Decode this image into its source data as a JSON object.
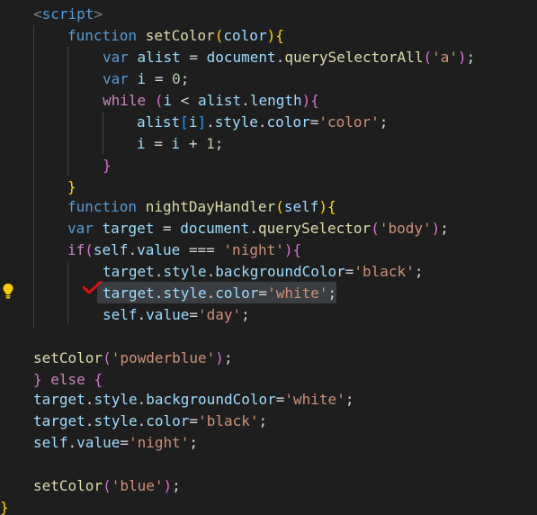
{
  "editor": {
    "background": "#1e1e1e",
    "colors": {
      "keyword": "#569cd6",
      "control": "#c586c0",
      "function": "#dcdcaa",
      "variable": "#9cdcfe",
      "string": "#ce9178",
      "number": "#b5cea8",
      "plain": "#d4d4d4",
      "bracket1": "#ffd700",
      "bracket2": "#da70d6",
      "bracket3": "#179fff",
      "tag": "#808080"
    },
    "lines": [
      [
        [
          "<",
          "tag"
        ],
        [
          "script",
          "keyword"
        ],
        [
          ">",
          "tag"
        ]
      ],
      [
        [
          "function",
          "keyword"
        ],
        [
          " ",
          "plain"
        ],
        [
          "setColor",
          "function"
        ],
        [
          "(",
          "bracket1"
        ],
        [
          "color",
          "variable"
        ],
        [
          "){",
          "bracket1"
        ]
      ],
      [
        [
          "var",
          "keyword"
        ],
        [
          " ",
          "plain"
        ],
        [
          "alist",
          "variable"
        ],
        [
          " = ",
          "plain"
        ],
        [
          "document",
          "variable"
        ],
        [
          ".",
          "plain"
        ],
        [
          "querySelectorAll",
          "function"
        ],
        [
          "(",
          "bracket2"
        ],
        [
          "'a'",
          "string"
        ],
        [
          ")",
          "bracket2"
        ],
        [
          ";",
          "plain"
        ]
      ],
      [
        [
          "var",
          "keyword"
        ],
        [
          " ",
          "plain"
        ],
        [
          "i",
          "variable"
        ],
        [
          " = ",
          "plain"
        ],
        [
          "0",
          "number"
        ],
        [
          ";",
          "plain"
        ]
      ],
      [
        [
          "while",
          "control"
        ],
        [
          " ",
          "plain"
        ],
        [
          "(",
          "bracket2"
        ],
        [
          "i",
          "variable"
        ],
        [
          " < ",
          "plain"
        ],
        [
          "alist",
          "variable"
        ],
        [
          ".",
          "plain"
        ],
        [
          "length",
          "variable"
        ],
        [
          ")",
          "bracket2"
        ],
        [
          "{",
          "bracket2"
        ]
      ],
      [
        [
          "alist",
          "variable"
        ],
        [
          "[",
          "bracket3"
        ],
        [
          "i",
          "variable"
        ],
        [
          "]",
          "bracket3"
        ],
        [
          ".",
          "plain"
        ],
        [
          "style",
          "variable"
        ],
        [
          ".",
          "plain"
        ],
        [
          "color",
          "variable"
        ],
        [
          "=",
          "plain"
        ],
        [
          "'color'",
          "string"
        ],
        [
          ";",
          "plain"
        ]
      ],
      [
        [
          "i",
          "variable"
        ],
        [
          " = ",
          "plain"
        ],
        [
          "i",
          "variable"
        ],
        [
          " + ",
          "plain"
        ],
        [
          "1",
          "number"
        ],
        [
          ";",
          "plain"
        ]
      ],
      [
        [
          "}",
          "bracket2"
        ]
      ],
      [
        [
          "}",
          "bracket1"
        ]
      ],
      [
        [
          "function",
          "keyword"
        ],
        [
          " ",
          "plain"
        ],
        [
          "nightDayHandler",
          "function"
        ],
        [
          "(",
          "bracket1"
        ],
        [
          "self",
          "variable"
        ],
        [
          "){",
          "bracket1"
        ]
      ],
      [
        [
          "var",
          "keyword"
        ],
        [
          " ",
          "plain"
        ],
        [
          "target",
          "variable"
        ],
        [
          " = ",
          "plain"
        ],
        [
          "document",
          "variable"
        ],
        [
          ".",
          "plain"
        ],
        [
          "querySelector",
          "function"
        ],
        [
          "(",
          "bracket2"
        ],
        [
          "'body'",
          "string"
        ],
        [
          ")",
          "bracket2"
        ],
        [
          ";",
          "plain"
        ]
      ],
      [
        [
          "if",
          "control"
        ],
        [
          "(",
          "bracket2"
        ],
        [
          "self",
          "variable"
        ],
        [
          ".",
          "plain"
        ],
        [
          "value",
          "variable"
        ],
        [
          " === ",
          "plain"
        ],
        [
          "'night'",
          "string"
        ],
        [
          ")",
          "bracket2"
        ],
        [
          "{",
          "bracket2"
        ]
      ],
      [
        [
          "target",
          "variable"
        ],
        [
          ".",
          "plain"
        ],
        [
          "style",
          "variable"
        ],
        [
          ".",
          "plain"
        ],
        [
          "backgroundColor",
          "variable"
        ],
        [
          "=",
          "plain"
        ],
        [
          "'black'",
          "string"
        ],
        [
          ";",
          "plain"
        ]
      ],
      [
        [
          "target",
          "variable"
        ],
        [
          ".",
          "plain"
        ],
        [
          "style",
          "variable"
        ],
        [
          ".",
          "plain"
        ],
        [
          "color",
          "variable"
        ],
        [
          "=",
          "plain"
        ],
        [
          "'white'",
          "string"
        ],
        [
          ";",
          "plain"
        ]
      ],
      [
        [
          "self",
          "variable"
        ],
        [
          ".",
          "plain"
        ],
        [
          "value",
          "variable"
        ],
        [
          "=",
          "plain"
        ],
        [
          "'day'",
          "string"
        ],
        [
          ";",
          "plain"
        ]
      ],
      [],
      [
        [
          "setColor",
          "function"
        ],
        [
          "(",
          "bracket2"
        ],
        [
          "'powderblue'",
          "string"
        ],
        [
          ")",
          "bracket2"
        ],
        [
          ";",
          "plain"
        ]
      ],
      [
        [
          "}",
          "bracket2"
        ],
        [
          " ",
          "plain"
        ],
        [
          "else",
          "control"
        ],
        [
          " ",
          "plain"
        ],
        [
          "{",
          "bracket2"
        ]
      ],
      [
        [
          "target",
          "variable"
        ],
        [
          ".",
          "plain"
        ],
        [
          "style",
          "variable"
        ],
        [
          ".",
          "plain"
        ],
        [
          "backgroundColor",
          "variable"
        ],
        [
          "=",
          "plain"
        ],
        [
          "'white'",
          "string"
        ],
        [
          ";",
          "plain"
        ]
      ],
      [
        [
          "target",
          "variable"
        ],
        [
          ".",
          "plain"
        ],
        [
          "style",
          "variable"
        ],
        [
          ".",
          "plain"
        ],
        [
          "color",
          "variable"
        ],
        [
          "=",
          "plain"
        ],
        [
          "'black'",
          "string"
        ],
        [
          ";",
          "plain"
        ]
      ],
      [
        [
          "self",
          "variable"
        ],
        [
          ".",
          "plain"
        ],
        [
          "value",
          "variable"
        ],
        [
          "=",
          "plain"
        ],
        [
          "'night'",
          "string"
        ],
        [
          ";",
          "plain"
        ]
      ],
      [],
      [
        [
          "setColor",
          "function"
        ],
        [
          "(",
          "bracket2"
        ],
        [
          "'blue'",
          "string"
        ],
        [
          ")",
          "bracket2"
        ],
        [
          ";",
          "plain"
        ]
      ],
      [
        [
          "}",
          "bracket1"
        ]
      ]
    ],
    "selected_line": 13,
    "gutter_icons": [
      "lightbulb-icon",
      "red-checkmark-icon"
    ]
  }
}
